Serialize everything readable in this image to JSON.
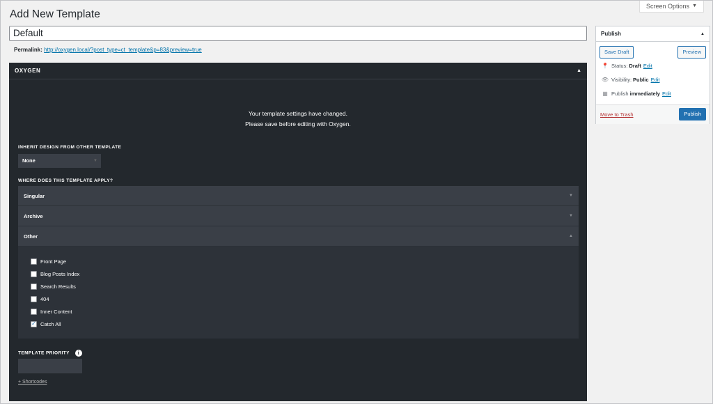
{
  "page": {
    "title": "Add New Template",
    "screen_options": "Screen Options"
  },
  "post": {
    "title_value": "Default",
    "permalink_label": "Permalink:",
    "permalink_url": "http://oxygen.local/?post_type=ct_template&p=83&preview=true"
  },
  "oxygen": {
    "header": "OXYGEN",
    "notice_line1": "Your template settings have changed.",
    "notice_line2": "Please save before editing with Oxygen.",
    "inherit_label": "INHERIT DESIGN FROM OTHER TEMPLATE",
    "inherit_value": "None",
    "where_label": "WHERE DOES THIS TEMPLATE APPLY?",
    "sections": [
      {
        "label": "Singular"
      },
      {
        "label": "Archive"
      },
      {
        "label": "Other"
      }
    ],
    "other_options": [
      {
        "label": "Front Page",
        "checked": false
      },
      {
        "label": "Blog Posts Index",
        "checked": false
      },
      {
        "label": "Search Results",
        "checked": false
      },
      {
        "label": "404",
        "checked": false
      },
      {
        "label": "Inner Content",
        "checked": false
      },
      {
        "label": "Catch All",
        "checked": true
      }
    ],
    "priority_label": "TEMPLATE PRIORITY",
    "shortcodes_link": "+ Shortcodes"
  },
  "publish": {
    "title": "Publish",
    "save_draft": "Save Draft",
    "preview": "Preview",
    "status_label": "Status:",
    "status_value": "Draft",
    "visibility_label": "Visibility:",
    "visibility_value": "Public",
    "publish_label": "Publish",
    "publish_value": "immediately",
    "edit": "Edit",
    "move_to_trash": "Move to Trash",
    "publish_button": "Publish"
  },
  "colors": {
    "accent": "#2271b1",
    "panel_bg": "#23282d",
    "trash": "#b32d2e"
  }
}
